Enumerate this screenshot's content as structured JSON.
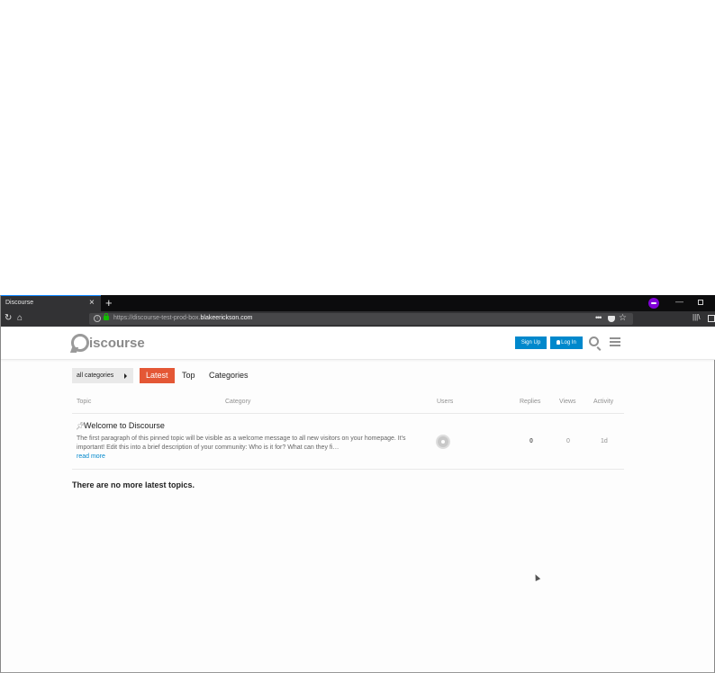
{
  "browser": {
    "tab_title": "Discourse",
    "tab_close": "×",
    "new_tab": "+",
    "url_prefix": "https://discourse-test-prod-box.",
    "url_domain": "blakeerickson.com",
    "minimize": "—",
    "icons": [
      "reload-icon",
      "home-icon",
      "info-icon",
      "lock-icon",
      "more-icon",
      "pocket-icon",
      "star-icon",
      "library-icon",
      "sidebar-icon",
      "private-mask-icon"
    ]
  },
  "header": {
    "logo_text": "iscourse",
    "signup_label": "Sign Up",
    "login_label": "Log In",
    "colors": {
      "primary": "#0088cc",
      "latest": "#e45735"
    }
  },
  "nav": {
    "categories_dropdown": "all categories",
    "pills": [
      "Latest",
      "Top",
      "Categories"
    ]
  },
  "table": {
    "headers": [
      "Topic",
      "Category",
      "Users",
      "Replies",
      "Views",
      "Activity"
    ],
    "rows": [
      {
        "title": "Welcome to Discourse",
        "excerpt": "The first paragraph of this pinned topic will be visible as a welcome message to all new visitors on your homepage. It's important! Edit this into a brief description of your community: Who is it for? What can they fi…",
        "read_more": "read more",
        "replies": "0",
        "views": "0",
        "activity": "1d"
      }
    ],
    "footer": "There are no more latest topics."
  }
}
